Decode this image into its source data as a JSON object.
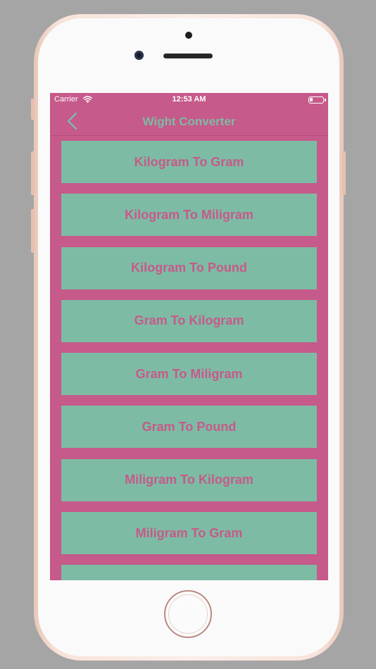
{
  "device": {
    "frame_color": "#f3d9ce",
    "background_color": "#a5a5a5"
  },
  "status_bar": {
    "carrier": "Carrier",
    "time": "12:53 AM",
    "icons": [
      "wifi-icon",
      "battery-icon"
    ]
  },
  "nav": {
    "title": "Wight Converter",
    "back_icon": "chevron-left-icon"
  },
  "colors": {
    "screen_bg": "#c65a8a",
    "item_bg": "#7dbba4",
    "item_text": "#c65a8a",
    "title_text": "#7fb9a5"
  },
  "items": [
    {
      "label": "Kilogram To Gram"
    },
    {
      "label": "Kilogram To Miligram"
    },
    {
      "label": "Kilogram To Pound"
    },
    {
      "label": "Gram To Kilogram"
    },
    {
      "label": "Gram To Miligram"
    },
    {
      "label": "Gram To Pound"
    },
    {
      "label": "Miligram To Kilogram"
    },
    {
      "label": "Miligram To Gram"
    },
    {
      "label": ""
    }
  ]
}
